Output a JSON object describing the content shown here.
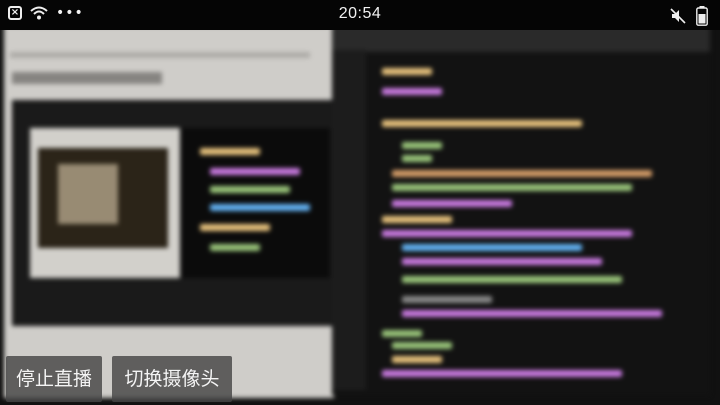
{
  "statusbar": {
    "time": "20:54",
    "left_icons": [
      "close-icon",
      "wifi-icon",
      "more-dots-icon"
    ],
    "right_icons": [
      "mute-icon",
      "battery-icon"
    ]
  },
  "preview": {
    "description_icon": "camera-preview"
  },
  "controls": {
    "stop_label": "停止直播",
    "switch_label": "切换摄像头"
  },
  "colors": {
    "overlay_button": "#464646",
    "code_bg": "#121212",
    "code_yellow": "#e5c07b",
    "code_green": "#98c379",
    "code_purple": "#c678dd",
    "code_blue": "#61afef"
  }
}
